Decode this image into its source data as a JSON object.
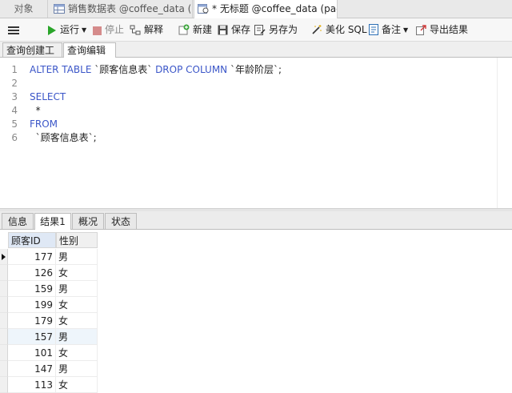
{
  "tabs": {
    "objects": "对象",
    "tab1": "销售数据表 @coffee_data (p...",
    "tab2": "* 无标题 @coffee_data (pac..."
  },
  "toolbar": {
    "run": "运行",
    "stop": "停止",
    "explain": "解释",
    "new": "新建",
    "save": "保存",
    "save_as": "另存为",
    "beautify": "美化 SQL",
    "comment": "备注",
    "export": "导出结果"
  },
  "subtabs": {
    "builder": "查询创建工具",
    "editor": "查询编辑器"
  },
  "editor": {
    "line_numbers": [
      "1",
      "2",
      "3",
      "4",
      "5",
      "6"
    ],
    "line1_kw1": "ALTER TABLE",
    "line1_tbl": " `顾客信息表` ",
    "line1_kw2": "DROP COLUMN",
    "line1_col": " `年龄阶层`;",
    "line3": "SELECT",
    "line4": "  *",
    "line5": "FROM",
    "line6": "  `顾客信息表`;"
  },
  "result_tabs": {
    "info": "信息",
    "result1": "结果1",
    "overview": "概况",
    "status": "状态"
  },
  "grid": {
    "columns": [
      "顾客ID",
      "性别"
    ],
    "rows": [
      {
        "id": "177",
        "gender": "男"
      },
      {
        "id": "126",
        "gender": "女"
      },
      {
        "id": "159",
        "gender": "男"
      },
      {
        "id": "199",
        "gender": "女"
      },
      {
        "id": "179",
        "gender": "女"
      },
      {
        "id": "157",
        "gender": "男"
      },
      {
        "id": "101",
        "gender": "女"
      },
      {
        "id": "147",
        "gender": "男"
      },
      {
        "id": "113",
        "gender": "女"
      }
    ]
  },
  "colors": {
    "keyword": "#3b56c8",
    "run_icon": "#2aa52a",
    "stop_icon": "#c23b3b"
  }
}
